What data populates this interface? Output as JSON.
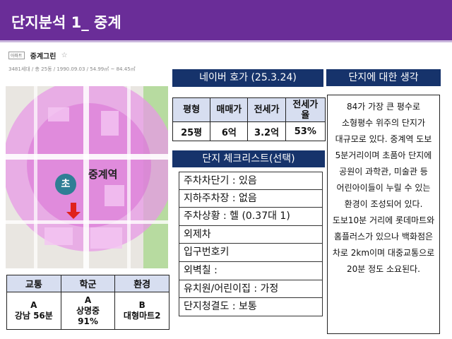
{
  "title": "단지분석 1_ 중계",
  "apartment": {
    "badge": "아파트",
    "name": "중계그린",
    "star": "☆",
    "info": "3481세대 / 총 25동 / 1990.09.03 / 54.99㎡ ~ 84.45㎡"
  },
  "map": {
    "station_label": "중계역",
    "school_marker": "초",
    "colors": {
      "zone": "#e79ae6",
      "zone_dark": "#d96fd6",
      "road": "#ffffff",
      "park": "#b7dba0",
      "arrow": "#e0221c"
    }
  },
  "naver": {
    "heading": "네이버 호가 (25.3.24)",
    "headers": [
      "평형",
      "매매가",
      "전세가",
      "전세가\n율"
    ],
    "row": [
      "25평",
      "6억",
      "3.2억",
      "53%"
    ]
  },
  "checklist": {
    "heading": "단지 체크리스트(선택)",
    "items": [
      "주차차단기 : 있음",
      "지하주차장 : 없음",
      "주차상황 : 헬 (0.37대 1)",
      "외제차",
      "입구번호키",
      "외벽칠 :",
      "유치원/어린이집 : 가정",
      "단지청결도 : 보통"
    ]
  },
  "thoughts": {
    "heading": "단지에 대한 생각",
    "text": "84가 가장 큰 평수로 소형평수 위주의 단지가 대규모로 있다. 중계역 도보 5분거리이며 초품아 단지에 공원이 과학관, 미술관 등 어린아이들이 누릴 수 있는 환경이 조성되어 있다. 도보10분 거리에 롯데마트와 홈플러스가 있으나 백화점은 차로 2km이며 대중교통으로 20분 정도 소요된다."
  },
  "grades": {
    "headers": [
      "교통",
      "학군",
      "환경"
    ],
    "cells": [
      {
        "grade": "A",
        "detail": "강남 56분"
      },
      {
        "grade": "A",
        "detail": "상명중\n91%"
      },
      {
        "grade": "B",
        "detail": "대형마트2"
      }
    ]
  },
  "colors": {
    "title_bar": "#6a2d98",
    "heading_bar": "#16336b",
    "table_header": "#d7def0"
  }
}
